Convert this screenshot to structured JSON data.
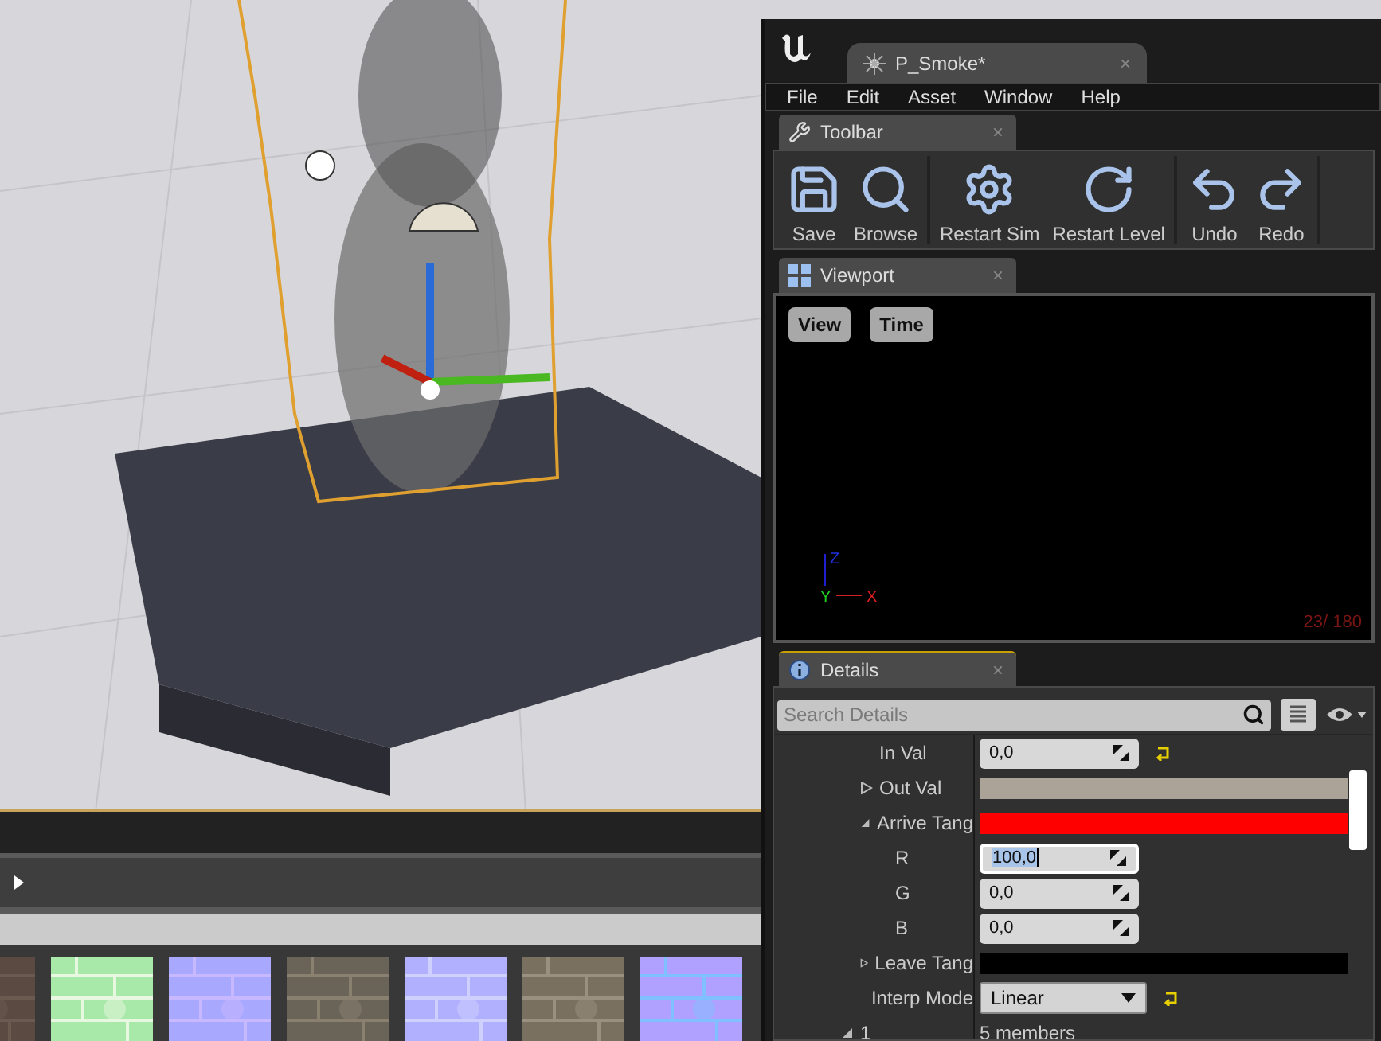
{
  "timeline": {
    "kind": "play"
  },
  "editor": {
    "document_tab": {
      "title": "P_Smoke*",
      "close": "×"
    },
    "menu": [
      "File",
      "Edit",
      "Asset",
      "Window",
      "Help"
    ],
    "toolbar": {
      "title": "Toolbar",
      "close": "×",
      "groups": [
        [
          {
            "label": "Save",
            "kind": "save"
          },
          {
            "label": "Browse",
            "kind": "browse"
          }
        ],
        [
          {
            "label": "Restart Sim",
            "kind": "restart_sim"
          },
          {
            "label": "Restart Level",
            "kind": "restart_level"
          }
        ],
        [
          {
            "label": "Undo",
            "kind": "undo"
          },
          {
            "label": "Redo",
            "kind": "redo"
          }
        ]
      ]
    },
    "viewport": {
      "title": "Viewport",
      "close": "×",
      "buttons": [
        "View",
        "Time"
      ],
      "axes": {
        "up": "Z",
        "side": "Y",
        "forward": "X"
      },
      "counter": "23/ 180"
    },
    "details": {
      "title": "Details",
      "close": "×",
      "search": {
        "placeholder": "Search Details"
      },
      "rows": [
        {
          "kind": "number",
          "label": "In Val",
          "value": "0,0",
          "reset": true,
          "focused": false
        },
        {
          "kind": "color",
          "label": "Out Val",
          "expanded": false,
          "color": "#aba398"
        },
        {
          "kind": "color",
          "label": "Arrive Tang",
          "expanded": true,
          "color": "#ff0000",
          "children": [
            {
              "kind": "number",
              "label": "R",
              "value": "100,0",
              "focused": true
            },
            {
              "kind": "number",
              "label": "G",
              "value": "0,0",
              "focused": false
            },
            {
              "kind": "number",
              "label": "B",
              "value": "0,0",
              "focused": false
            }
          ]
        },
        {
          "kind": "color",
          "label": "Leave Tang",
          "expanded": false,
          "color": "#000000"
        },
        {
          "kind": "dropdown",
          "label": "Interp Mode",
          "value": "Linear",
          "reset": true
        }
      ],
      "next_element": {
        "label": "1",
        "expanded": true,
        "value": "5 members"
      }
    }
  }
}
